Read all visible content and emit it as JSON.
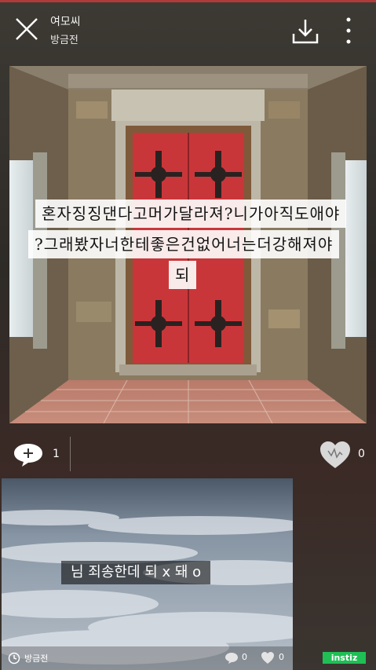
{
  "header": {
    "author": "여모씨",
    "time": "방금전"
  },
  "post": {
    "caption_lines": [
      "혼자징징댄다고머가달라져?니가아직도애야",
      "?그래봤자너한테좋은건없어너는더강해져야",
      "되"
    ],
    "comment_count": "1",
    "like_count": "0"
  },
  "next_post": {
    "caption": "님 죄송한데 되 x 돼 o",
    "time": "방금전",
    "comment_count": "0",
    "like_count": "0"
  },
  "brand": "instiz",
  "colors": {
    "door": "#c9363a",
    "brand_green": "#1fbf55",
    "top_accent": "#b03a3a"
  }
}
